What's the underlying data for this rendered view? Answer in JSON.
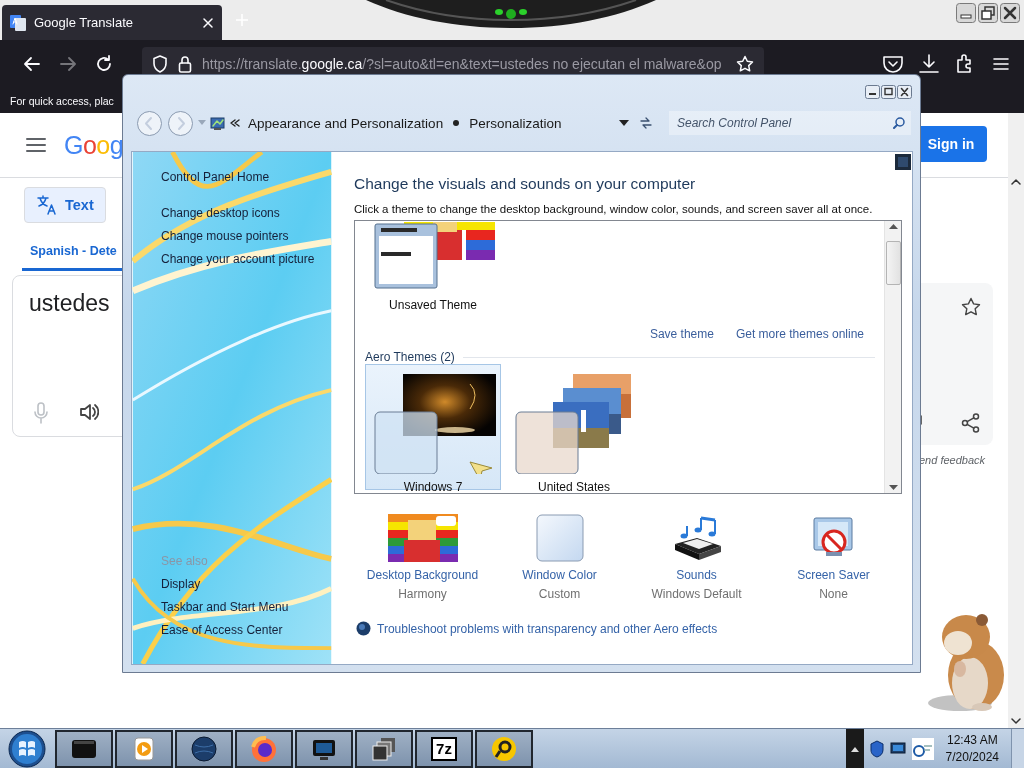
{
  "browser": {
    "tab": {
      "title": "Google Translate",
      "selected": true
    },
    "url": "https://translate.**google.ca**/?sl=auto&tl=en&text=ustedes no ejecutan el malware&op",
    "bookmarks_hint": "For quick access, plac"
  },
  "page": {
    "logo": "Goog",
    "sign_in": "Sign in",
    "modes": [
      {
        "label": "Text",
        "selected": true
      }
    ],
    "source_language": "Spanish - Dete",
    "input_text": "ustedes",
    "feedback": "end feedback"
  },
  "control_panel": {
    "breadcrumb": [
      "Appearance and Personalization",
      "Personalization"
    ],
    "search": {
      "placeholder": "Search Control Panel"
    },
    "sidebar": {
      "home": "Control Panel Home",
      "links": [
        "Change desktop icons",
        "Change mouse pointers",
        "Change your account picture"
      ],
      "see_also_heading": "See also",
      "see_also": [
        "Display",
        "Taskbar and Start Menu",
        "Ease of Access Center"
      ]
    },
    "heading": "Change the visuals and sounds on your computer",
    "instructions": "Click a theme to change the desktop background, window color, sounds, and screen saver all at once.",
    "my_themes": [
      {
        "name": "Unsaved Theme",
        "kind": "unsaved",
        "selected": false
      }
    ],
    "save_theme": "Save theme",
    "get_more": "Get more themes online",
    "aero_group": "Aero Themes (2)",
    "aero_themes": [
      {
        "name": "Windows 7",
        "kind": "win7",
        "selected": true
      },
      {
        "name": "United States",
        "kind": "usa",
        "selected": false
      }
    ],
    "settings": [
      {
        "kind": "background",
        "label": "Desktop Background",
        "value": "Harmony"
      },
      {
        "kind": "color",
        "label": "Window Color",
        "value": "Custom"
      },
      {
        "kind": "sounds",
        "label": "Sounds",
        "value": "Windows Default"
      },
      {
        "kind": "saver",
        "label": "Screen Saver",
        "value": "None"
      }
    ],
    "troubleshoot": "Troubleshoot problems with transparency and other Aero effects"
  },
  "taskbar": {
    "buttons": [
      {
        "kind": "terminal"
      },
      {
        "kind": "media"
      },
      {
        "kind": "globe"
      },
      {
        "kind": "firefox"
      },
      {
        "kind": "screen"
      },
      {
        "kind": "windows"
      },
      {
        "kind": "archive",
        "label": "7z"
      },
      {
        "kind": "viewer"
      }
    ],
    "time": "12:43 AM",
    "date": "7/20/2024"
  }
}
